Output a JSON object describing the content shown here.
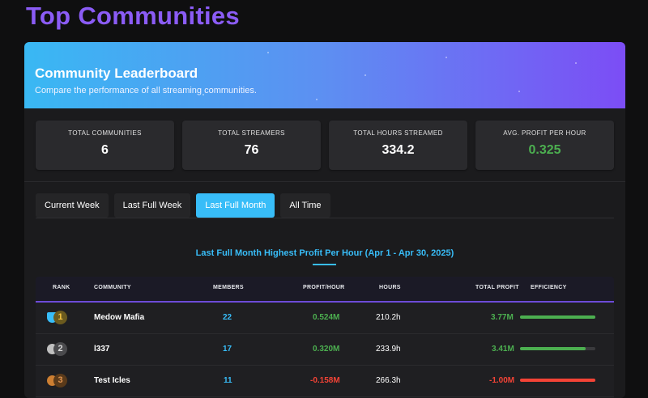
{
  "page": {
    "title": "Top Communities"
  },
  "banner": {
    "title": "Community Leaderboard",
    "subtitle": "Compare the performance of all streaming communities."
  },
  "stats": [
    {
      "label": "TOTAL COMMUNITIES",
      "value": "6",
      "color": "#ffffff"
    },
    {
      "label": "TOTAL STREAMERS",
      "value": "76",
      "color": "#ffffff"
    },
    {
      "label": "TOTAL HOURS STREAMED",
      "value": "334.2",
      "color": "#ffffff"
    },
    {
      "label": "AVG. PROFIT PER HOUR",
      "value": "0.325",
      "color": "#4caf50"
    }
  ],
  "tabs": [
    {
      "label": "Current Week",
      "active": false
    },
    {
      "label": "Last Full Week",
      "active": false
    },
    {
      "label": "Last Full Month",
      "active": true
    },
    {
      "label": "All Time",
      "active": false
    }
  ],
  "section": {
    "title": "Last Full Month Highest Profit Per Hour (Apr 1 - Apr 30, 2025)"
  },
  "table": {
    "headers": [
      "RANK",
      "COMMUNITY",
      "MEMBERS",
      "PROFIT/HOUR",
      "HOURS",
      "TOTAL PROFIT",
      "EFFICIENCY"
    ],
    "rows": [
      {
        "rank": "1",
        "medal": "trophy-icon",
        "medal_color": "#f5c542",
        "community": "Medow Mafia",
        "members": "22",
        "profit_per_hour": "0.524M",
        "hours": "210.2h",
        "total_profit": "3.77M",
        "efficiency": 1.0,
        "trend": "positive"
      },
      {
        "rank": "2",
        "medal": "silver-medal-icon",
        "medal_color": "#c0c0c0",
        "community": "l337",
        "members": "17",
        "profit_per_hour": "0.320M",
        "hours": "233.9h",
        "total_profit": "3.41M",
        "efficiency": 0.87,
        "trend": "positive"
      },
      {
        "rank": "3",
        "medal": "bronze-medal-icon",
        "medal_color": "#cd7f32",
        "community": "Test Icles",
        "members": "11",
        "profit_per_hour": "-0.158M",
        "hours": "266.3h",
        "total_profit": "-1.00M",
        "efficiency": 1.0,
        "trend": "negative"
      }
    ]
  },
  "colors": {
    "accent_purple": "#8b5cf6",
    "accent_blue": "#38bdf8",
    "positive": "#4caf50",
    "negative": "#f44336"
  }
}
